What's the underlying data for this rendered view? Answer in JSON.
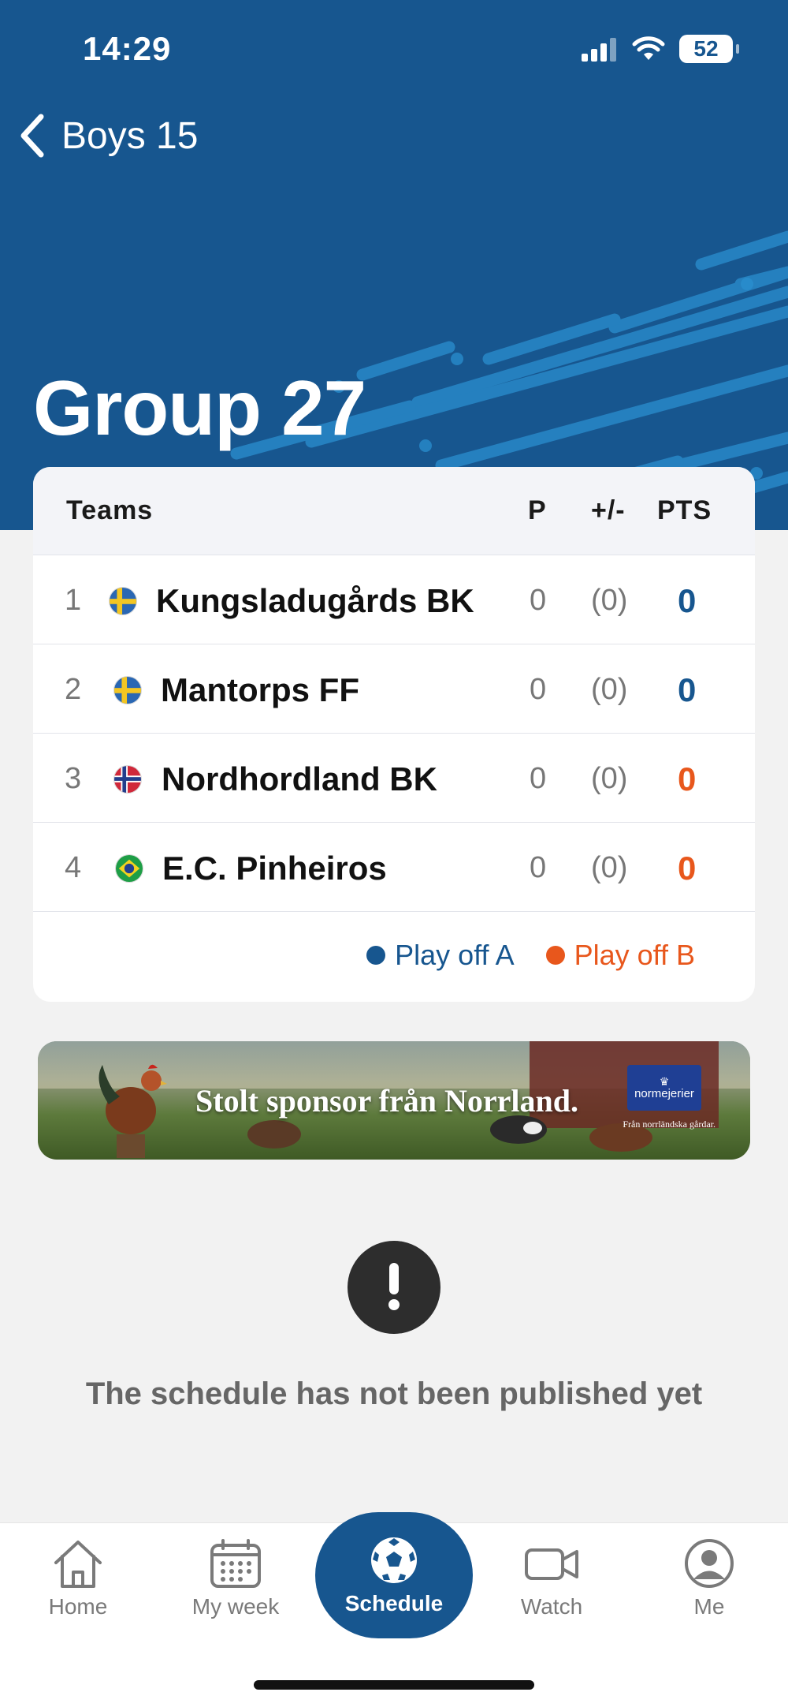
{
  "status_bar": {
    "time": "14:29",
    "battery": "52"
  },
  "nav": {
    "back_label": "Boys 15"
  },
  "page": {
    "title": "Group 27"
  },
  "standings": {
    "headers": {
      "teams": "Teams",
      "played": "P",
      "diff": "+/-",
      "points": "PTS"
    },
    "rows": [
      {
        "pos": "1",
        "flag": "sweden-flag-icon",
        "team": "Kungsladugårds BK",
        "played": "0",
        "diff": "(0)",
        "points": "0",
        "playoff": "A"
      },
      {
        "pos": "2",
        "flag": "sweden-flag-icon",
        "team": "Mantorps FF",
        "played": "0",
        "diff": "(0)",
        "points": "0",
        "playoff": "A"
      },
      {
        "pos": "3",
        "flag": "norway-flag-icon",
        "team": "Nordhordland BK",
        "played": "0",
        "diff": "(0)",
        "points": "0",
        "playoff": "B"
      },
      {
        "pos": "4",
        "flag": "brazil-flag-icon",
        "team": "E.C. Pinheiros",
        "played": "0",
        "diff": "(0)",
        "points": "0",
        "playoff": "B"
      }
    ],
    "legend": {
      "a": "Play off A",
      "b": "Play off B"
    }
  },
  "banner": {
    "text": "Stolt sponsor från Norrland.",
    "logo": "normejerier",
    "tagline": "Från norrländska gårdar."
  },
  "notice": {
    "icon": "exclamation-icon",
    "text": "The schedule has not been published yet"
  },
  "tabs": [
    {
      "label": "Home",
      "icon": "home-icon"
    },
    {
      "label": "My week",
      "icon": "calendar-icon"
    },
    {
      "label": "Schedule",
      "icon": "soccer-ball-icon",
      "active": true
    },
    {
      "label": "Watch",
      "icon": "video-camera-icon"
    },
    {
      "label": "Me",
      "icon": "user-icon"
    }
  ],
  "colors": {
    "primary": "#17568f",
    "playoff_a": "#17568f",
    "playoff_b": "#e8571c",
    "background": "#f2f2f2"
  }
}
